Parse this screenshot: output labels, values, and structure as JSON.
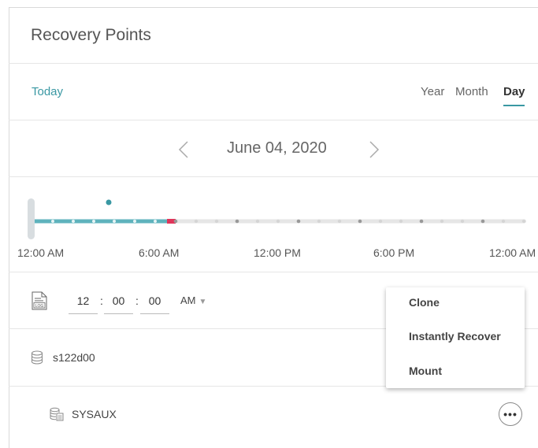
{
  "header": {
    "title": "Recovery Points"
  },
  "toolbar": {
    "today_label": "Today",
    "granularity": [
      "Year",
      "Month",
      "Day"
    ],
    "active_granularity": "Day"
  },
  "date_nav": {
    "date": "June 04, 2020",
    "prev_icon": "chevron-left-icon",
    "next_icon": "chevron-right-icon"
  },
  "timeline": {
    "tick_labels": [
      "12:00 AM",
      "6:00 AM",
      "12:00 PM",
      "6:00 PM",
      "12:00 AM"
    ],
    "colors": {
      "accent": "#5fb3bd",
      "marker": "#e0355a",
      "track": "#e6e6e6",
      "handle": "#d8dde0",
      "point_dark": "#999999",
      "point_light": "#d5d5d5"
    }
  },
  "time_input": {
    "icon": "log-file-icon",
    "hour": "12",
    "minute": "00",
    "second": "00",
    "ampm": "AM"
  },
  "database": {
    "icon": "database-icon",
    "name": "s122d00"
  },
  "tablespace": {
    "icon": "tablespace-icon",
    "name": "SYSAUX",
    "more_label": "•••"
  },
  "context_menu": {
    "items": [
      "Clone",
      "Instantly Recover",
      "Mount"
    ]
  }
}
